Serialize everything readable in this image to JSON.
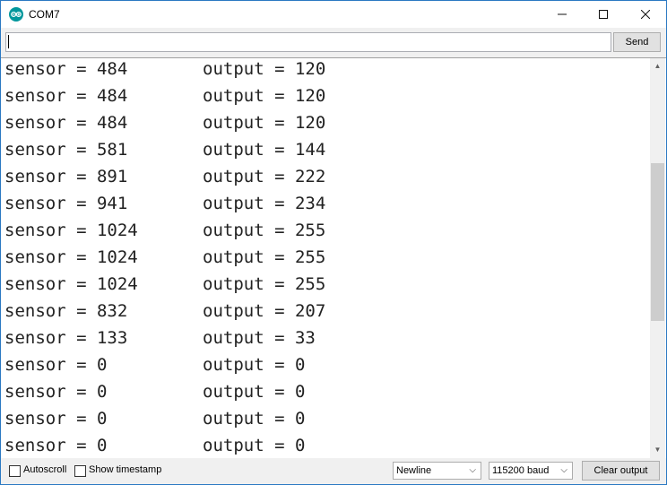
{
  "window": {
    "title": "COM7",
    "minimize": "—",
    "maximize": "☐",
    "close": "✕"
  },
  "input": {
    "value": "",
    "send_label": "Send"
  },
  "output": {
    "lines": [
      {
        "sensor": "sensor = 484",
        "output": "output = 120"
      },
      {
        "sensor": "sensor = 484",
        "output": "output = 120"
      },
      {
        "sensor": "sensor = 484",
        "output": "output = 120"
      },
      {
        "sensor": "sensor = 581",
        "output": "output = 144"
      },
      {
        "sensor": "sensor = 891",
        "output": "output = 222"
      },
      {
        "sensor": "sensor = 941",
        "output": "output = 234"
      },
      {
        "sensor": "sensor = 1024",
        "output": "output = 255"
      },
      {
        "sensor": "sensor = 1024",
        "output": "output = 255"
      },
      {
        "sensor": "sensor = 1024",
        "output": "output = 255"
      },
      {
        "sensor": "sensor = 832",
        "output": "output = 207"
      },
      {
        "sensor": "sensor = 133",
        "output": "output = 33"
      },
      {
        "sensor": "sensor = 0",
        "output": "output = 0"
      },
      {
        "sensor": "sensor = 0",
        "output": "output = 0"
      },
      {
        "sensor": "sensor = 0",
        "output": "output = 0"
      },
      {
        "sensor": "sensor = 0",
        "output": "output = 0"
      }
    ]
  },
  "footer": {
    "autoscroll_label": "Autoscroll",
    "autoscroll_checked": false,
    "timestamp_label": "Show timestamp",
    "timestamp_checked": false,
    "line_ending": "Newline",
    "baud_rate": "115200 baud",
    "clear_label": "Clear output"
  },
  "icons": {
    "app": "arduino-icon",
    "dropdown": "chevron-down-icon"
  },
  "colors": {
    "app_icon": "#00979c",
    "window_border": "#2b79c2"
  }
}
